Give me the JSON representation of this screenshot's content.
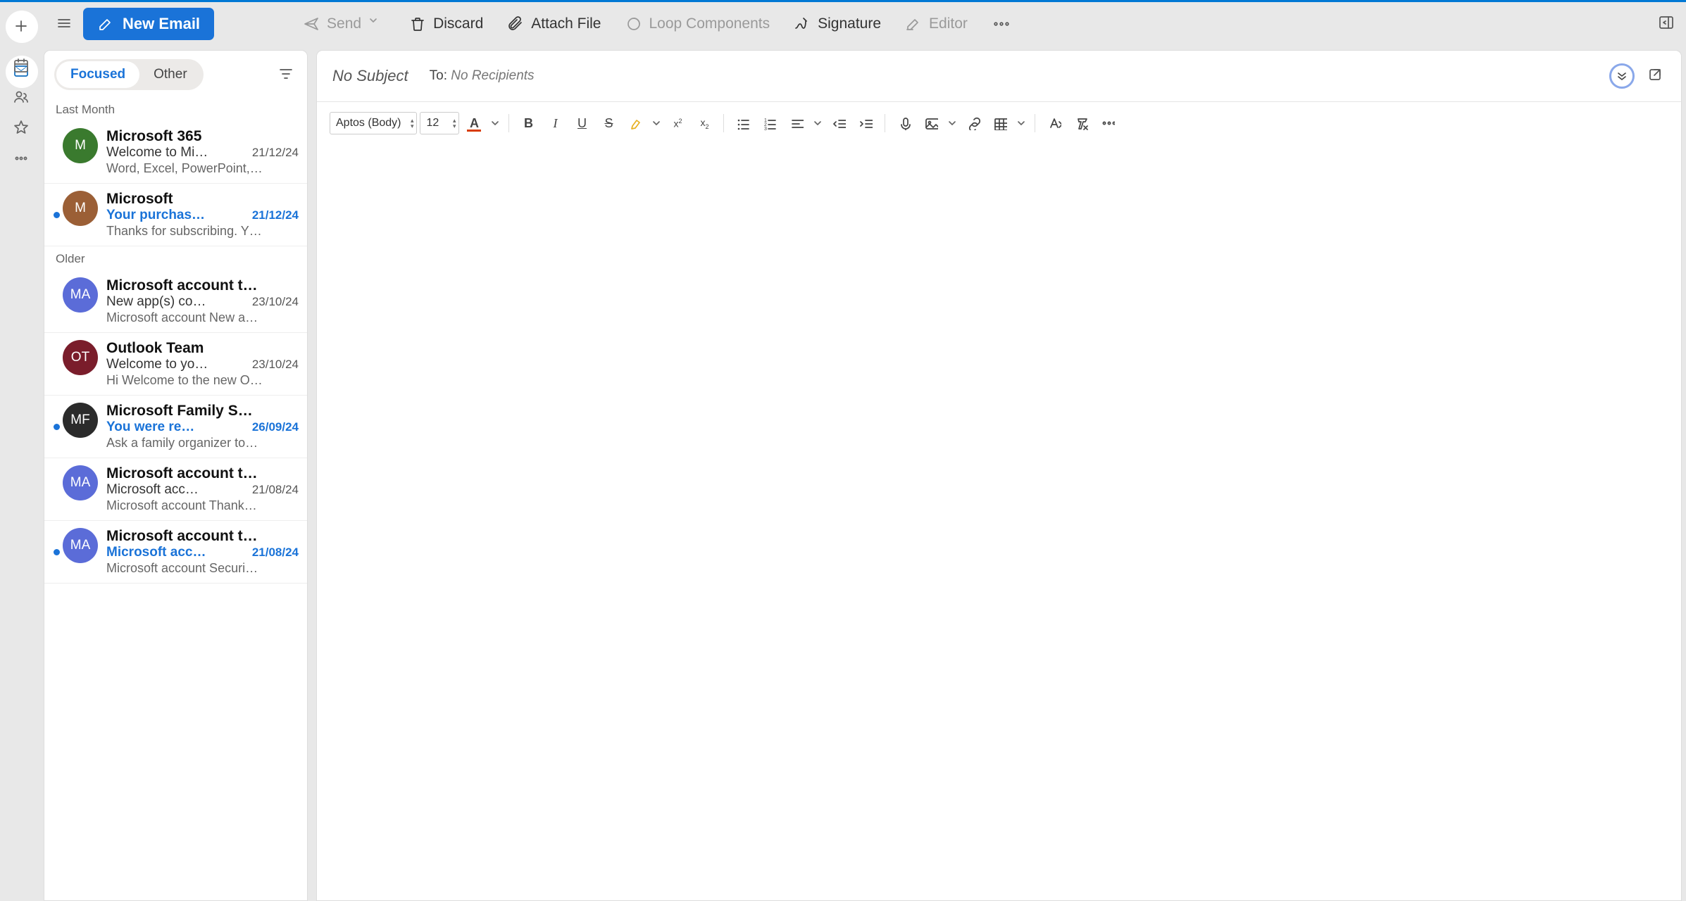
{
  "topbar": {
    "new_email": "New Email",
    "send": "Send",
    "discard": "Discard",
    "attach_file": "Attach File",
    "loop_components": "Loop Components",
    "signature": "Signature",
    "editor": "Editor"
  },
  "tabs": {
    "focused": "Focused",
    "other": "Other"
  },
  "groups": {
    "last_month": "Last Month",
    "older": "Older"
  },
  "emails": [
    {
      "avatar": "M",
      "avatar_bg": "#3a7a2e",
      "sender": "Microsoft 365",
      "subject": "Welcome to Mi…",
      "date": "21/12/24",
      "preview": "Word, Excel, PowerPoint,…",
      "unread": false
    },
    {
      "avatar": "M",
      "avatar_bg": "#9b5f36",
      "sender": "Microsoft",
      "subject": "Your purchas…",
      "date": "21/12/24",
      "preview": "Thanks for subscribing. Y…",
      "unread": true
    },
    {
      "avatar": "MA",
      "avatar_bg": "#5b6cd8",
      "sender": "Microsoft account t…",
      "subject": "New app(s) co…",
      "date": "23/10/24",
      "preview": "Microsoft account New a…",
      "unread": false
    },
    {
      "avatar": "OT",
      "avatar_bg": "#7a1d2b",
      "sender": "Outlook Team",
      "subject": "Welcome to yo…",
      "date": "23/10/24",
      "preview": "Hi Welcome to the new O…",
      "unread": false
    },
    {
      "avatar": "MF",
      "avatar_bg": "#2b2b2b",
      "sender": "Microsoft Family S…",
      "subject": "You were re…",
      "date": "26/09/24",
      "preview": "Ask a family organizer to…",
      "unread": true
    },
    {
      "avatar": "MA",
      "avatar_bg": "#5b6cd8",
      "sender": "Microsoft account t…",
      "subject": "Microsoft acc…",
      "date": "21/08/24",
      "preview": "Microsoft account Thank…",
      "unread": false
    },
    {
      "avatar": "MA",
      "avatar_bg": "#5b6cd8",
      "sender": "Microsoft account t…",
      "subject": "Microsoft acc…",
      "date": "21/08/24",
      "preview": "Microsoft account Securi…",
      "unread": true
    }
  ],
  "compose": {
    "no_subject": "No Subject",
    "to_label": "To:",
    "no_recipients": "No Recipients",
    "font_family": "Aptos (Body)",
    "font_size": "12"
  }
}
